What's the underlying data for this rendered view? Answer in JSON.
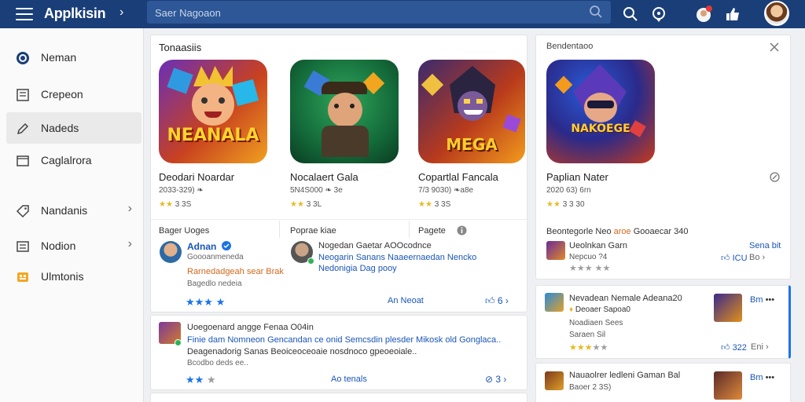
{
  "header": {
    "app_title": "Applkisin",
    "search_placeholder": "Saer Nagoaon"
  },
  "sidebar": {
    "items": [
      {
        "label": "Neman",
        "icon": "circle-badge-icon"
      },
      {
        "label": "Crepeon",
        "icon": "document-icon"
      },
      {
        "label": "Nadeds",
        "icon": "pencil-icon"
      },
      {
        "label": "Caglalrora",
        "icon": "folder-icon"
      },
      {
        "label": "Nandanis",
        "icon": "tag-icon"
      },
      {
        "label": "Nodion",
        "icon": "list-icon"
      },
      {
        "label": "Ulmtonis",
        "icon": "grid-orange-icon"
      }
    ]
  },
  "featured": {
    "section_title": "Tonaasiis",
    "games": [
      {
        "name": "Deodari Noardar",
        "meta": "2033-329) ❧",
        "rating": "3 3S",
        "art_text": "NEANALA"
      },
      {
        "name": "Nocalaert Gala",
        "meta": "5N4S000 ❧ 3e",
        "rating": "3 3L",
        "art_text": ""
      },
      {
        "name": "Copartlal Fancala",
        "meta": "7/3 9030) ❧a8e",
        "rating": "3 3S",
        "art_text": "MEGA"
      }
    ],
    "col_heads": [
      "Bager Uoges",
      "Poprae kiae",
      "Pagete"
    ]
  },
  "review1": {
    "author": "Adnan",
    "sub": "Goooanmeneda",
    "tag": "Rarnedadgeah sear Brak",
    "sub2": "Bagedlo nedeia",
    "action": "An Neoat"
  },
  "review2": {
    "line1": "Nogedan Gaetar AOOcodnce",
    "line2": "Neogarin Sanans Naaeernaedan Nencko",
    "line3": "Nedonigia Dag pooy"
  },
  "review3": {
    "title": "Uoegoenard angge Fenaa O04in",
    "body": "Finie dam Nomneon Gencandan ce onid Semcsdin plesder Mikosk old Gonglaca..",
    "body2": "Deagenadorig Sanas Beoiceoceoaie nosdnoco gpeoeoiale..",
    "sub": "Bcodbo deds ee..",
    "action": "Ao tenals"
  },
  "right_panel": {
    "header": "Bendentaoo",
    "game_name": "Paplian Nater",
    "game_meta": "2020 63) 6rn",
    "game_rating": "3 3 30",
    "art_text": "NAKOEGE",
    "info_line": "Beontegorle Neo",
    "info_hl": "aroe",
    "info_tail": "Gooaecar 340",
    "item1_title": "Ueolnkan Garn",
    "item1_sub": "Nepcuo ?4",
    "item1_action": "Sena bit",
    "item1_count": "ICU"
  },
  "list_card1": {
    "title": "Nevadean Nemale Adeana20",
    "sub": "Deoaer Sapoa0",
    "sub2": "Noadiaen Sees",
    "sub3": "Saraen Sil",
    "count": "322",
    "action": "Eni",
    "side": "Bm"
  },
  "list_card2": {
    "title": "Nauaolrer ledleni Gaman Bal",
    "sub": "Baoer 2 3S)",
    "side": "Bm"
  },
  "colors": {
    "header": "#1a3e78",
    "accent": "#1a73e8",
    "gold": "#e8b923"
  }
}
